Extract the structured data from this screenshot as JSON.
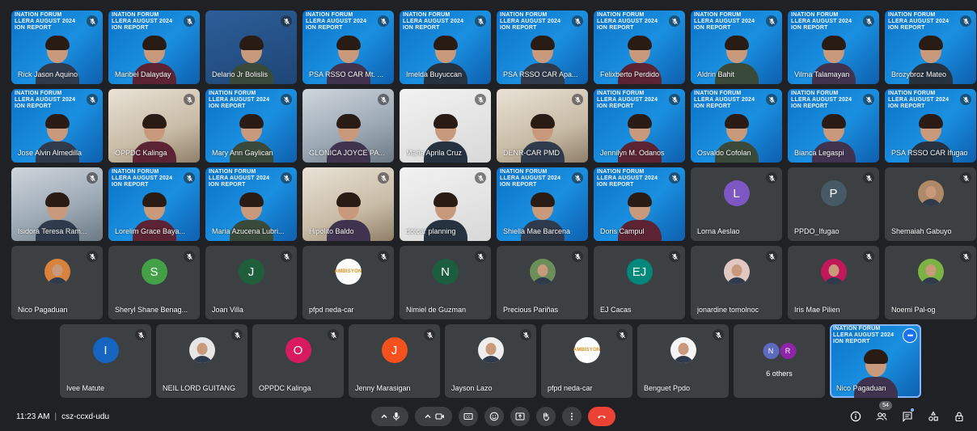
{
  "meeting": {
    "time": "11:23 AM",
    "code": "csz-ccxd-udu"
  },
  "banner_text": "INATION FORUM\nLLERA AUGUST 2024\nION REPORT",
  "rows": [
    [
      {
        "name": "Rick Jason Aquino",
        "type": "video",
        "kind": "banner"
      },
      {
        "name": "Maribel Dalayday",
        "type": "video",
        "kind": "banner"
      },
      {
        "name": "Delario Jr Bolislis",
        "type": "video",
        "kind": "blue"
      },
      {
        "name": "PSA RSSO CAR Mt. ...",
        "type": "video",
        "kind": "banner"
      },
      {
        "name": "Imelda Buyuccan",
        "type": "video",
        "kind": "banner"
      },
      {
        "name": "PSA RSSO CAR Apa...",
        "type": "video",
        "kind": "banner"
      },
      {
        "name": "Felixberto Perdido",
        "type": "video",
        "kind": "banner"
      },
      {
        "name": "Aldrin Bahit",
        "type": "video",
        "kind": "banner"
      },
      {
        "name": "Vilma Talamayan",
        "type": "video",
        "kind": "banner"
      },
      {
        "name": "Brozybroz Mateo",
        "type": "video",
        "kind": "banner"
      }
    ],
    [
      {
        "name": "Jose Alvin Almedilla",
        "type": "video",
        "kind": "banner"
      },
      {
        "name": "OPPDC Kalinga",
        "type": "video",
        "kind": "room"
      },
      {
        "name": "Mary Ann Gaylican",
        "type": "video",
        "kind": "banner"
      },
      {
        "name": "GLONICA JOYCE PA...",
        "type": "video",
        "kind": "office"
      },
      {
        "name": "Maria Aprila Cruz",
        "type": "video",
        "kind": "white"
      },
      {
        "name": "DENR-CAR PMD",
        "type": "video",
        "kind": "room"
      },
      {
        "name": "Jennilyn M. Odanos",
        "type": "video",
        "kind": "banner"
      },
      {
        "name": "Osvaldo Cofolan",
        "type": "video",
        "kind": "banner"
      },
      {
        "name": "Bianca Legaspi",
        "type": "video",
        "kind": "banner"
      },
      {
        "name": "PSA RSSO CAR Ifugao",
        "type": "video",
        "kind": "banner"
      }
    ],
    [
      {
        "name": "Isidora Teresa Ram...",
        "type": "video",
        "kind": "office"
      },
      {
        "name": "Lorelim Grace Baya...",
        "type": "video",
        "kind": "banner"
      },
      {
        "name": "Maria Azucena Lubri...",
        "type": "video",
        "kind": "banner"
      },
      {
        "name": "Hipolito Baldo",
        "type": "video",
        "kind": "room"
      },
      {
        "name": "dotcar planning",
        "type": "video",
        "kind": "white"
      },
      {
        "name": "Shiella Mae Barcena",
        "type": "video",
        "kind": "banner"
      },
      {
        "name": "Doris Campul",
        "type": "video",
        "kind": "banner"
      },
      {
        "name": "Lorna Aeslao",
        "type": "avatar",
        "letter": "L",
        "color": "#7e57c2"
      },
      {
        "name": "PPDO_Ifugao",
        "type": "avatar",
        "letter": "P",
        "color": "#455a64"
      },
      {
        "name": "Shemaiah Gabuyo",
        "type": "photo",
        "color": "#b08968"
      }
    ],
    [
      {
        "name": "Nico Pagaduan",
        "type": "photo",
        "color": "#d9823b"
      },
      {
        "name": "Sheryl Shane Benag...",
        "type": "avatar",
        "letter": "S",
        "color": "#43a047"
      },
      {
        "name": "Joan Villa",
        "type": "avatar",
        "letter": "J",
        "color": "#1e5e3b"
      },
      {
        "name": "pfpd neda-car",
        "type": "logo",
        "logo": "AMBISYON"
      },
      {
        "name": "Nimiel de Guzman",
        "type": "avatar",
        "letter": "N",
        "color": "#1b5e3f"
      },
      {
        "name": "Precious Pariñas",
        "type": "photo",
        "color": "#6b8e5a"
      },
      {
        "name": "EJ Cacas",
        "type": "avatar",
        "letter": "EJ",
        "color": "#00897b"
      },
      {
        "name": "jonardine tomolnoc",
        "type": "photo",
        "color": "#e0c8c0"
      },
      {
        "name": "Iris Mae Pilien",
        "type": "photo",
        "color": "#c2185b"
      },
      {
        "name": "Noemi Pal-og",
        "type": "photo",
        "color": "#7cb342"
      }
    ],
    [
      {
        "name": "Ivee Matute",
        "type": "avatar",
        "letter": "I",
        "color": "#1565c0"
      },
      {
        "name": "NEIL LORD GUITANG",
        "type": "photo",
        "color": "#e6e6e6"
      },
      {
        "name": "OPPDC Kalinga",
        "type": "avatar",
        "letter": "O",
        "color": "#d81b60"
      },
      {
        "name": "Jenny Marasigan",
        "type": "avatar",
        "letter": "J",
        "color": "#f4511e"
      },
      {
        "name": "Jayson Lazo",
        "type": "photo",
        "color": "#eeeeee"
      },
      {
        "name": "pfpd neda-car",
        "type": "logo",
        "logo": "AMBISYON"
      },
      {
        "name": "Benguet Ppdo",
        "type": "photo",
        "color": "#f5f5f5"
      },
      {
        "name": "6 others",
        "type": "others",
        "letters": [
          "N",
          "R"
        ],
        "colors": [
          "#5c6bc0",
          "#8e24aa"
        ]
      },
      {
        "name": "Nico Pagaduan",
        "type": "self",
        "kind": "banner"
      }
    ]
  ],
  "participants_count": "54",
  "icons": {
    "mute": "mic-off-icon",
    "mic": "mic-icon",
    "camera": "camera-icon",
    "captions": "captions-icon",
    "emoji": "emoji-icon",
    "present": "present-screen-icon",
    "hand": "raise-hand-icon",
    "more": "more-options-icon",
    "hangup": "hang-up-icon",
    "info": "info-icon",
    "people": "people-icon",
    "chat": "chat-icon",
    "activities": "activities-icon",
    "lock": "host-controls-icon"
  }
}
